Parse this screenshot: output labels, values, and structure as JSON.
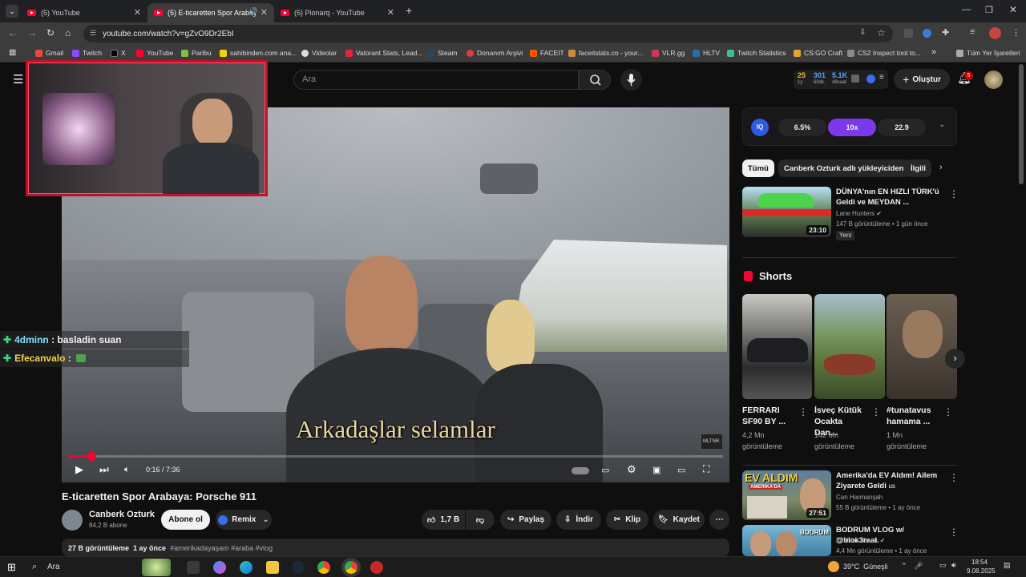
{
  "browser": {
    "tabs": [
      {
        "label": "(5) YouTube",
        "active": false
      },
      {
        "label": "(5) E-ticaretten Spor Arabay",
        "active": true
      },
      {
        "label": "(5) Pionarq - YouTube",
        "active": false
      }
    ],
    "url": "youtube.com/watch?v=gZvO9Dr2EbI",
    "bookmarks": [
      "Gmail",
      "Twitch",
      "X",
      "YouTube",
      "Paribu",
      "sahibinden.com ana...",
      "Videolar",
      "Valorant Stats, Lead...",
      "Steam",
      "Donanım Arşivi",
      "FACEIT",
      "faceitstats.co - your...",
      "VLR.gg",
      "HLTV",
      "Twitch Statistics",
      "CS:GO Craft",
      "CS2 Inspect tool to..."
    ],
    "bookmarks_more": "»",
    "all_bookmarks": "Tüm Yer İşaretleri"
  },
  "youtube": {
    "search_placeholder": "Ara",
    "create_label": "Oluştur",
    "notif_count": "5",
    "stats": {
      "a": "25",
      "a_sub": "1y",
      "b": "301",
      "b_sub": "60dk.",
      "c": "5.1K",
      "c_sub": "48saat"
    }
  },
  "overlay": {
    "chat": [
      {
        "user": "4dminn",
        "sep": " : ",
        "msg": "basladin suan",
        "color": "#7fe0ff"
      },
      {
        "user": "Efecanvalo",
        "sep": " : ",
        "msg": "",
        "color": "#f2d24a"
      }
    ]
  },
  "player": {
    "caption": "Arkadaşlar selamlar",
    "time": "0:16 / 7:36",
    "progress": 0.035,
    "watermark": "MLTNR."
  },
  "video": {
    "title": "E-ticaretten Spor Arabaya: Porsche 911",
    "channel": "Canberk Ozturk",
    "subs": "84,2 B abone",
    "subscribe": "Abone ol",
    "remix": "Remix",
    "likes": "1,7 B",
    "share": "Paylaş",
    "download": "İndir",
    "clip": "Klip",
    "save": "Kaydet",
    "desc": "27 B görüntüleme  1 ay önce ",
    "tags": "#amerikadayaşam #araba #vlog"
  },
  "sidebar": {
    "ext": {
      "logo": "IQ",
      "v1": "6.5%",
      "v2": "10x",
      "v3": "22.9"
    },
    "chips": [
      "Tümü",
      "Canberk Ozturk adlı yükleyiciden",
      "İlgili"
    ],
    "rec1": {
      "title": "DÜNYA'nın EN HIZLI TÜRK'ü Geldi ve MEYDAN ...",
      "channel": "Lane Hunters",
      "meta": "147 B görüntüleme • 1 gün önce",
      "badge": "Yeni",
      "duration": "23:10"
    },
    "shorts_title": "Shorts",
    "shorts": [
      {
        "title": "FERRARI SF90 BY ...",
        "views": "4,2 Mn görüntüleme"
      },
      {
        "title": "İsveç Kütük Ocakta Dan...",
        "views": "142 Mn görüntüleme"
      },
      {
        "title": "#tunatavus hamama ...",
        "views": "1 Mn görüntüleme"
      }
    ],
    "rec2": {
      "title": "Amerika'da EV Aldım! Ailem Ziyarete Geldi",
      "title_suffix": "us",
      "channel": "Can Harmanşah",
      "meta": "55 B görüntüleme • 1 ay önce",
      "duration": "27:51",
      "thumb_text": "EV ALDIM",
      "thumb_sub": "AMERİKA'DA"
    },
    "rec3": {
      "title": "BODRUM VLOG w/ @blok3real.",
      "channel": "İbrahim Tilaver",
      "meta": "4,4 Mn görüntüleme • 1 ay önce",
      "thumb_text": "BODRUM"
    }
  },
  "taskbar": {
    "search": "Ara",
    "weather": "39°C  Güneşli",
    "time": "18:54",
    "date": "9.08.2025"
  }
}
